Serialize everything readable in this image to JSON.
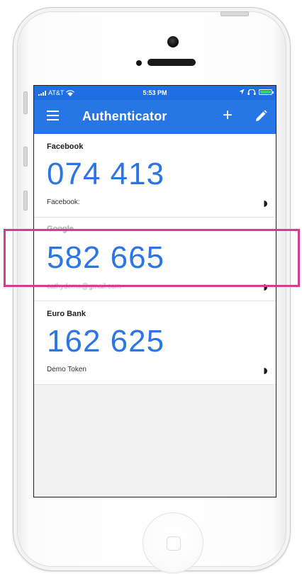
{
  "status_bar": {
    "carrier": "AT&T",
    "time": "5:53 PM"
  },
  "app_bar": {
    "title": "Authenticator"
  },
  "accounts": [
    {
      "issuer": "Facebook",
      "code": "074 413",
      "label": "Facebook:"
    },
    {
      "issuer": "Google",
      "code": "582 665",
      "label": "cathydemo@gmail.com"
    },
    {
      "issuer": "Euro Bank",
      "code": "162 625",
      "label": "Demo Token"
    }
  ],
  "colors": {
    "app_bar": "#2776e6",
    "code_text": "#2b76e5",
    "highlight": "#d63a93"
  },
  "icons": {
    "menu": "hamburger-menu-icon",
    "add": "plus-icon",
    "edit": "pencil-icon",
    "timer": "countdown-timer-icon",
    "wifi": "wifi-icon",
    "battery": "battery-icon"
  }
}
